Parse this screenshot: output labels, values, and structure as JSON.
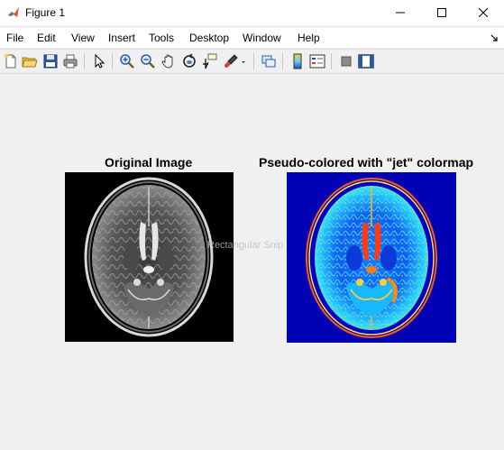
{
  "window": {
    "title": "Figure 1",
    "controls": [
      "minimize",
      "maximize",
      "close"
    ]
  },
  "menu": {
    "items": [
      "File",
      "Edit",
      "View",
      "Insert",
      "Tools",
      "Desktop",
      "Window",
      "Help"
    ]
  },
  "toolbar": {
    "buttons": [
      "new-figure-icon",
      "open-file-icon",
      "save-icon",
      "print-icon",
      "edit-plot-icon",
      "zoom-in-icon",
      "zoom-out-icon",
      "pan-icon",
      "rotate-3d-icon",
      "data-cursor-icon",
      "brush-icon",
      "link-plot-icon",
      "colorbar-icon",
      "legend-icon",
      "hide-plot-tools-icon",
      "show-plot-tools-icon"
    ]
  },
  "axes": [
    {
      "title": "Original Image",
      "colormap": "gray"
    },
    {
      "title": "Pseudo-colored with \"jet\" colormap",
      "colormap": "jet"
    }
  ],
  "tooltip": {
    "text": "Rectangular Snip"
  },
  "colors": {
    "jet_background": "#0000b4",
    "gray_background": "#000000",
    "window_bg": "#f0f0f0"
  }
}
